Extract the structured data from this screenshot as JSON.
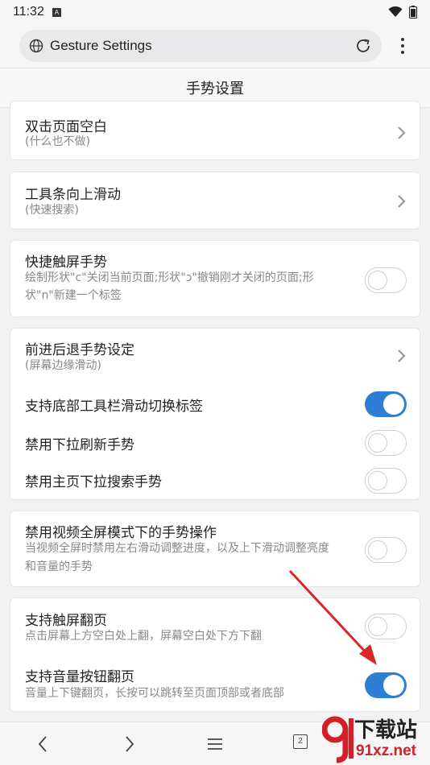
{
  "status_bar": {
    "time": "11:32",
    "notification_icon": "A"
  },
  "browser": {
    "url_text": "Gesture Settings"
  },
  "page": {
    "title": "手势设置"
  },
  "settings": {
    "double_tap": {
      "title": "双击页面空白",
      "sub": "(什么也不做)"
    },
    "toolbar_swipe_up": {
      "title": "工具条向上滑动",
      "sub": "(快速搜索)"
    },
    "quick_touch": {
      "title": "快捷触屏手势",
      "sub_line1": "绘制形状\"c\"关闭当前页面;形状\"ɔ\"撤销刚才关闭的页面;形",
      "sub_line2": "状\"n\"新建一个标签",
      "enabled": false
    },
    "back_forward": {
      "title": "前进后退手势设定",
      "sub": "(屏幕边缘滑动)"
    },
    "bottom_toolbar_swipe": {
      "title": "支持底部工具栏滑动切换标签",
      "enabled": true
    },
    "disable_pull_refresh": {
      "title": "禁用下拉刷新手势",
      "enabled": false
    },
    "disable_home_pull_search": {
      "title": "禁用主页下拉搜索手势",
      "enabled": false
    },
    "disable_video_fullscreen": {
      "title": "禁用视频全屏模式下的手势操作",
      "sub_line1": "当视频全屏时禁用左右滑动调整进度，以及上下滑动调整亮度",
      "sub_line2": "和音量的手势",
      "enabled": false
    },
    "touch_page_turn": {
      "title": "支持触屏翻页",
      "sub": "点击屏幕上方空白处上翻，屏幕空白处下方下翻",
      "enabled": false
    },
    "volume_page_turn": {
      "title": "支持音量按钮翻页",
      "sub": "音量上下键翻页，长按可以跳转至页面顶部或者底部",
      "enabled": true
    }
  },
  "bottom_nav": {
    "tab_count": "2"
  },
  "watermark": {
    "cn": "下载站",
    "en": "91xz.net"
  },
  "colors": {
    "accent": "#2d7fd6",
    "arrow": "#d9262b"
  }
}
